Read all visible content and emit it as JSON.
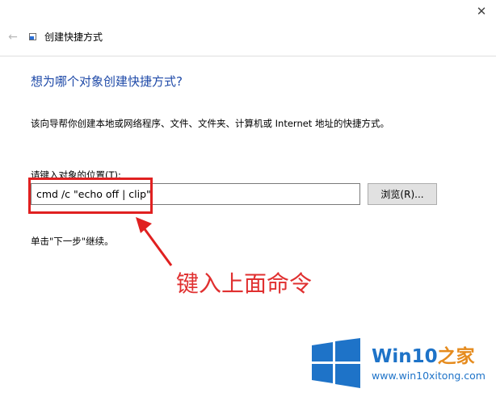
{
  "window": {
    "title": "创建快捷方式",
    "back_glyph": "←",
    "close_glyph": "✕"
  },
  "wizard": {
    "heading": "想为哪个对象创建快捷方式?",
    "description": "该向导帮你创建本地或网络程序、文件、文件夹、计算机或 Internet 地址的快捷方式。",
    "location_label": "请键入对象的位置(T):",
    "location_value": "cmd /c \"echo off | clip\"",
    "browse_label": "浏览(R)...",
    "continue_hint": "单击\"下一步\"继续。"
  },
  "annotation": {
    "text": "键入上面命令",
    "color": "#e03030"
  },
  "watermark": {
    "brand_main": "Win10",
    "brand_suffix": "之家",
    "url": "www.win10xitong.com",
    "brand_color": "#1e73c8",
    "suffix_color": "#e58b1e"
  },
  "icons": [
    "back-arrow-icon",
    "shortcut-app-icon",
    "close-icon",
    "windows-logo-icon",
    "annotation-arrow-icon"
  ]
}
